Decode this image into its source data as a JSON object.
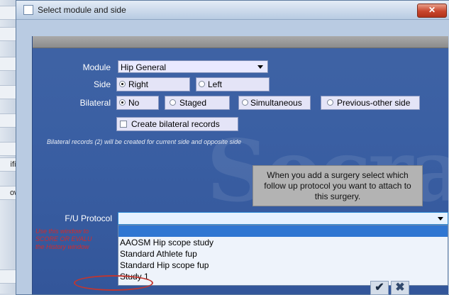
{
  "background_app": {
    "stubs": [
      "",
      "",
      "",
      "",
      "",
      "",
      "ific",
      "ow",
      ""
    ]
  },
  "dialog": {
    "title": "Select module and side",
    "close_glyph": "✕"
  },
  "form": {
    "module_label": "Module",
    "module_value": "Hip General",
    "side_label": "Side",
    "side_options": [
      {
        "label": "Right",
        "selected": true
      },
      {
        "label": "Left",
        "selected": false
      }
    ],
    "bilateral_label": "Bilateral",
    "bilateral_options": [
      {
        "label": "No",
        "selected": true
      },
      {
        "label": "Staged",
        "selected": false
      },
      {
        "label": "Simultaneous",
        "selected": false
      },
      {
        "label": "Previous-other side",
        "selected": false
      }
    ],
    "create_bilateral_label": "Create bilateral records",
    "create_bilateral_checked": false,
    "bilateral_note": "Bilateral records (2) will be created  for current side and opposite side",
    "info_text": "When you add a surgery select which follow up protocol you want to attach to this surgery.",
    "fu_protocol_label": "F/U Protocol",
    "fu_protocol_value": "",
    "red_note_lines": [
      "Use this window to",
      "SCORE OR EVALU",
      "the History window"
    ],
    "dropdown_options": [
      "",
      "AAOSM Hip scope study",
      "Standard Athlete fup",
      "Standard Hip scope fup",
      "Study 1"
    ],
    "highlighted_option_index": 0
  },
  "buttons": {
    "ok_glyph": "✔",
    "cancel_glyph": "✖"
  },
  "watermark": "Socra",
  "colors": {
    "panel_blue": "#3a5fa3",
    "selection_blue": "#2f76d2",
    "annotation_red": "#c2362f",
    "close_red": "#c8452c"
  }
}
